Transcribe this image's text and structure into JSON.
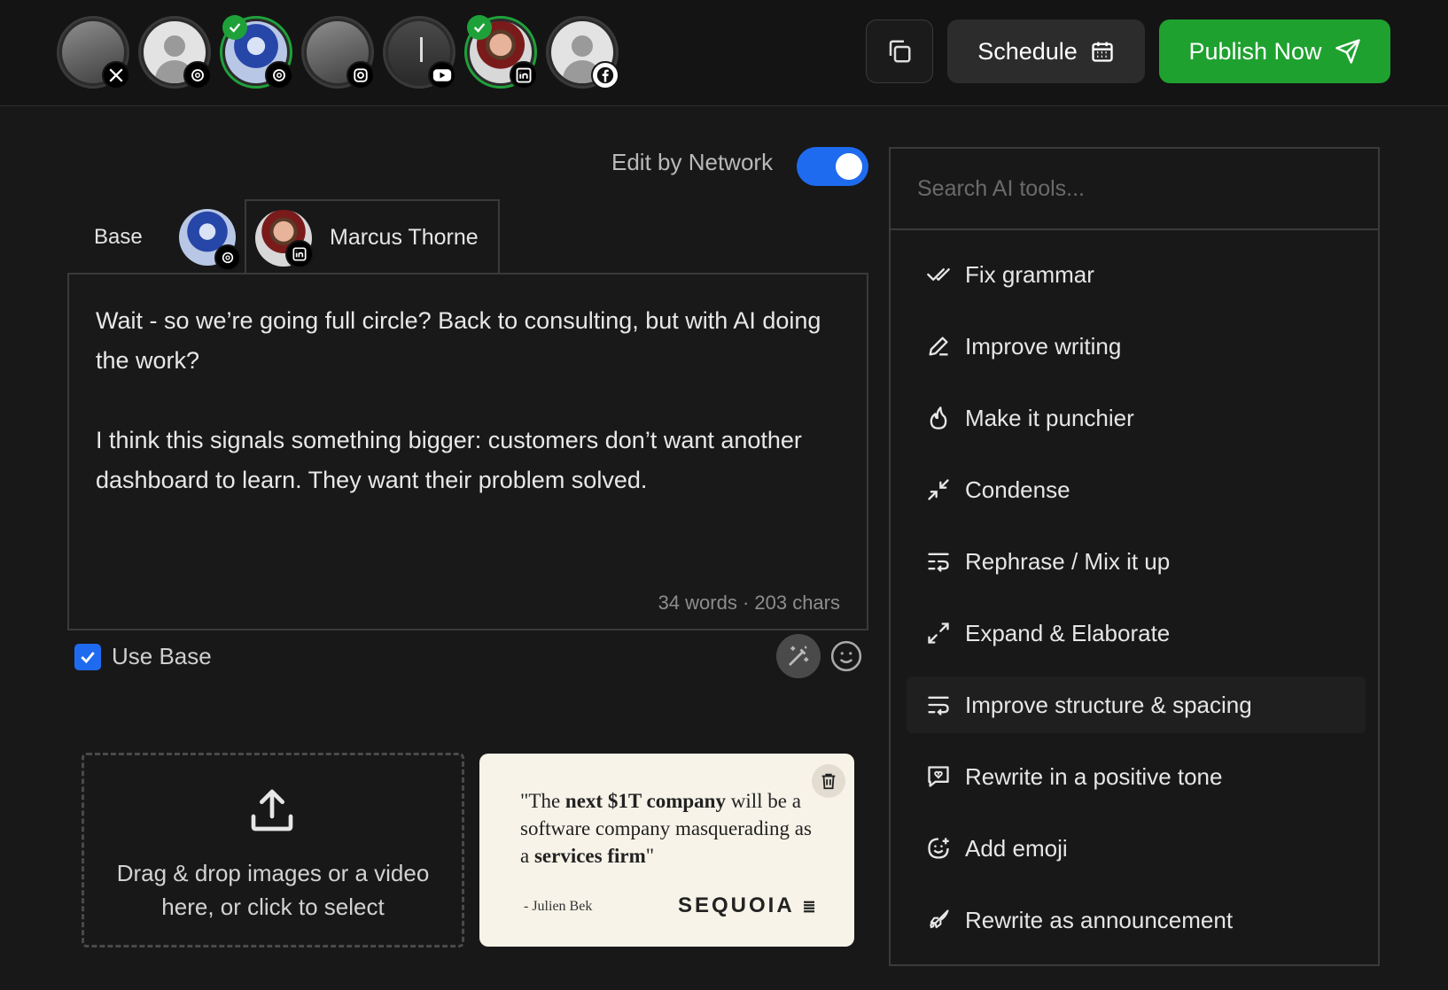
{
  "accounts": [
    {
      "network": "x",
      "badge": "X",
      "selected": false
    },
    {
      "network": "threads",
      "badge": "@",
      "selected": false
    },
    {
      "network": "threads",
      "badge": "@",
      "selected": true
    },
    {
      "network": "instagram",
      "badge": "ig",
      "selected": false
    },
    {
      "network": "youtube",
      "badge": "yt",
      "selected": false
    },
    {
      "network": "linkedin",
      "badge": "in",
      "selected": true
    },
    {
      "network": "facebook",
      "badge": "f",
      "selected": false
    }
  ],
  "toolbar": {
    "schedule_label": "Schedule",
    "publish_label": "Publish Now"
  },
  "edit_by_network": {
    "label": "Edit by Network",
    "enabled": true
  },
  "tabs": {
    "base_label": "Base",
    "active_label": "Marcus Thorne"
  },
  "editor": {
    "text": "Wait - so we’re going full circle? Back to consulting, but with AI doing the work?\n\nI think this signals something bigger: customers don’t want another dashboard to learn. They want their problem solved.",
    "count": "34 words · 203 chars"
  },
  "use_base": {
    "label": "Use Base",
    "checked": true
  },
  "upload": {
    "label": "Drag & drop images or a video here, or click to select"
  },
  "quote_card": {
    "q_open": "\"The ",
    "q_b1": "next $1T company",
    "q_mid": " will be a software company masquerading as a ",
    "q_b2": "services firm",
    "q_close": "\"",
    "author": "- Julien Bek",
    "logo": "SEQUOIA"
  },
  "ai_tools": {
    "search_placeholder": "Search AI tools...",
    "items": [
      {
        "label": "Fix grammar",
        "icon": "double-check-icon"
      },
      {
        "label": "Improve writing",
        "icon": "pencil-icon"
      },
      {
        "label": "Make it punchier",
        "icon": "flame-icon"
      },
      {
        "label": "Condense",
        "icon": "minimize-icon"
      },
      {
        "label": "Rephrase / Mix it up",
        "icon": "rephrase-icon"
      },
      {
        "label": "Expand & Elaborate",
        "icon": "maximize-icon"
      },
      {
        "label": "Improve structure & spacing",
        "icon": "wrap-text-icon"
      },
      {
        "label": "Rewrite in a positive tone",
        "icon": "message-heart-icon"
      },
      {
        "label": "Add emoji",
        "icon": "smile-plus-icon"
      },
      {
        "label": "Rewrite as announcement",
        "icon": "rocket-icon"
      }
    ]
  },
  "colors": {
    "accent_blue": "#1f6bf0",
    "publish_green": "#1ea12f",
    "selected_ring": "#1fa13a"
  }
}
